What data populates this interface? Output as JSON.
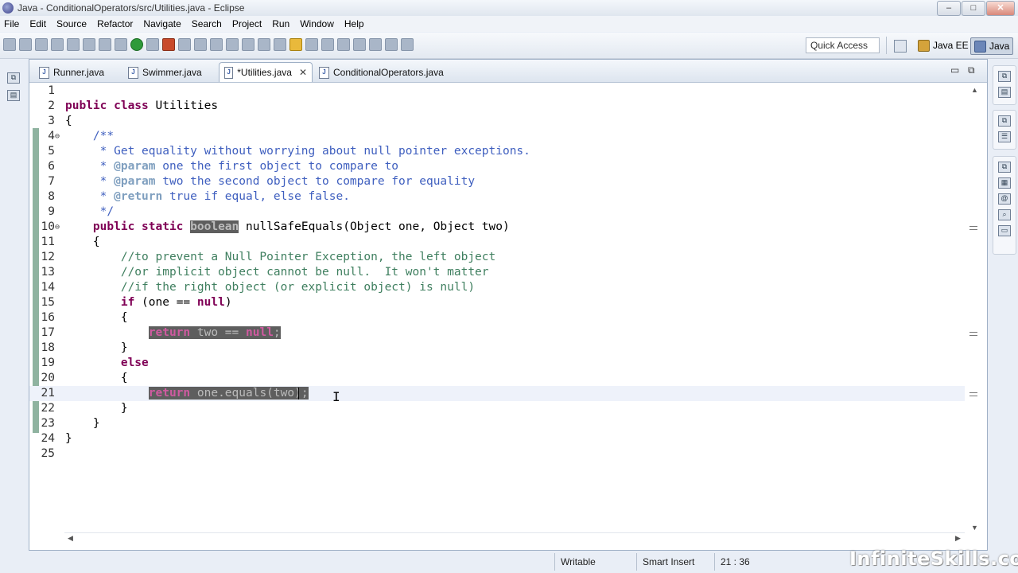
{
  "window": {
    "title": "Java - ConditionalOperators/src/Utilities.java - Eclipse",
    "controls": {
      "minimize": "–",
      "maximize": "□",
      "close": "✕"
    }
  },
  "menu": [
    "File",
    "Edit",
    "Source",
    "Refactor",
    "Navigate",
    "Search",
    "Project",
    "Run",
    "Window",
    "Help"
  ],
  "toolbar": {
    "quick_access": "Quick Access",
    "perspectives": [
      "Java EE",
      "Java"
    ]
  },
  "tabs": [
    {
      "label": "Runner.java",
      "active": false
    },
    {
      "label": "Swimmer.java",
      "active": false
    },
    {
      "label": "*Utilities.java",
      "active": true
    },
    {
      "label": "ConditionalOperators.java",
      "active": false
    }
  ],
  "code": {
    "line_numbers": [
      "1",
      "2",
      "3",
      "4",
      "5",
      "6",
      "7",
      "8",
      "9",
      "10",
      "11",
      "12",
      "13",
      "14",
      "15",
      "16",
      "17",
      "18",
      "19",
      "20",
      "21",
      "22",
      "23",
      "24",
      "25"
    ],
    "l2_kw": "public class",
    "l2_rest": " Utilities",
    "l3": "{",
    "l4": "    /**",
    "l5": "     * Get equality without worrying about null pointer exceptions.",
    "l6_pre": "     * ",
    "l6_tag": "@param",
    "l6_rest": " one the first object to compare to",
    "l7_pre": "     * ",
    "l7_tag": "@param",
    "l7_rest": " two the second object to compare for equality",
    "l8_pre": "     * ",
    "l8_tag": "@return",
    "l8_rest": " true if equal, else false.",
    "l9": "     */",
    "l10_indent": "    ",
    "l10_kw": "public static",
    "l10_sp": " ",
    "l10_type": "boolean",
    "l10_rest": " nullSafeEquals(Object one, Object two)",
    "l11": "    {",
    "l12": "        //to prevent a Null Pointer Exception, the left object",
    "l13": "        //or implicit object cannot be null.  It won't matter",
    "l14": "        //if the right object (or explicit object) is null)",
    "l15_indent": "        ",
    "l15_kw": "if",
    "l15_mid": " (one == ",
    "l15_null": "null",
    "l15_end": ")",
    "l16": "        {",
    "l17_indent": "            ",
    "l17_kw": "return",
    "l17_mid": " two == ",
    "l17_null": "null",
    "l17_end": ";",
    "l18": "        }",
    "l19_indent": "        ",
    "l19_kw": "else",
    "l20": "        {",
    "l21_indent": "            ",
    "l21_kw": "return",
    "l21_rest": " one.equals(two);",
    "l22": "        }",
    "l23": "    }",
    "l24": "}"
  },
  "status": {
    "writable": "Writable",
    "insert_mode": "Smart Insert",
    "position": "21 : 36"
  },
  "brand": "InfiniteSkills.com"
}
